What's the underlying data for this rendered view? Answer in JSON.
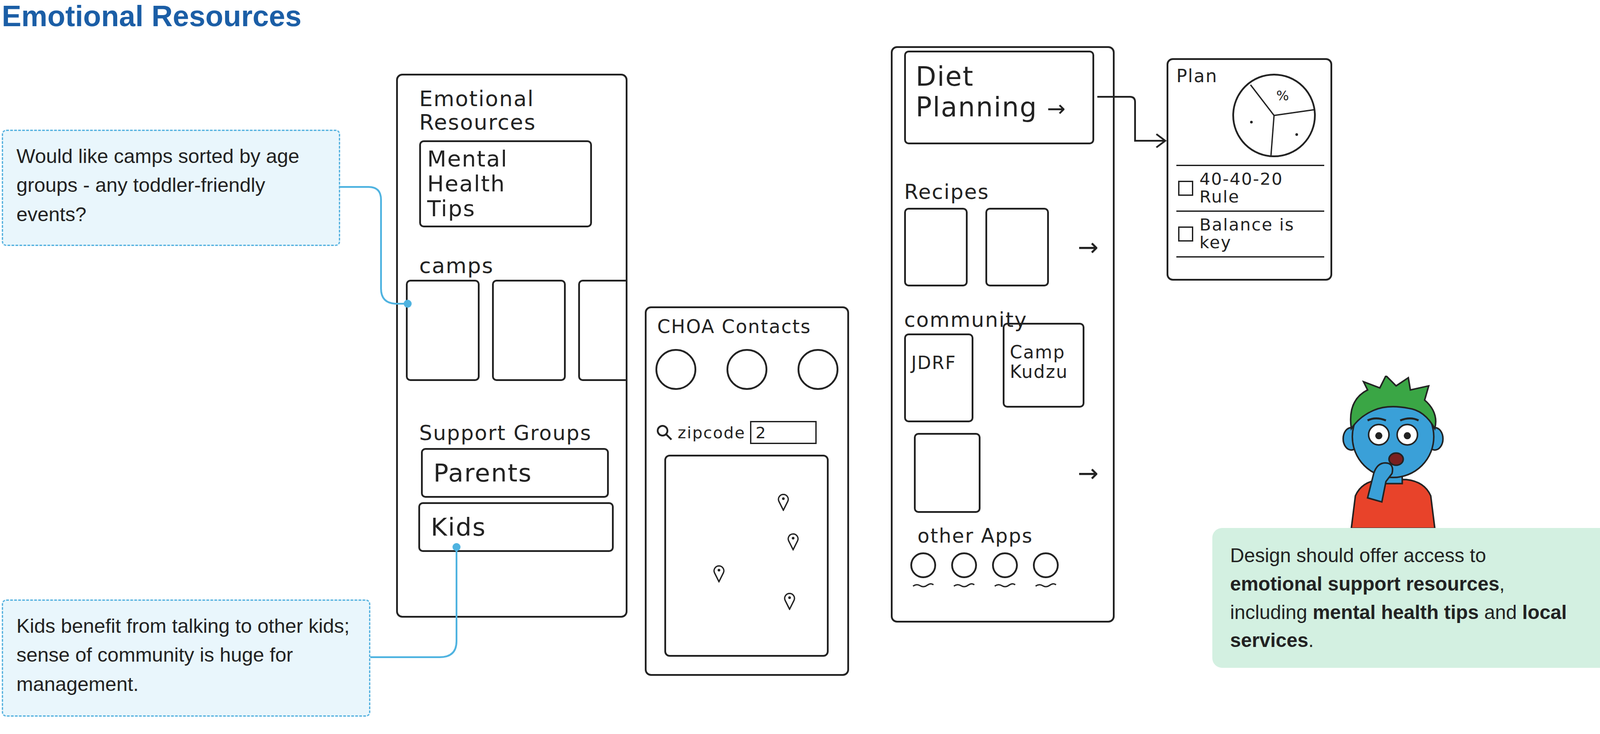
{
  "title": "Emotional Resources",
  "notes": [
    {
      "text": "Would like camps sorted by age groups - any toddler-friendly events?"
    },
    {
      "text": "Kids benefit from talking to other kids; sense of community is huge for management."
    }
  ],
  "emotional_screen": {
    "title": "Emotional Resources",
    "tips": "Mental Health Tips",
    "camps_label": "camps",
    "support_label": "Support Groups",
    "groups": [
      "Parents",
      "Kids"
    ]
  },
  "contacts_screen": {
    "title": "CHOA Contacts",
    "search_label": "zipcode",
    "search_value": "2"
  },
  "diet_screen": {
    "title": "Diet Planning",
    "title_arrow": "→",
    "recipes_label": "Recipes",
    "recipes_arrow": "→",
    "community_label": "community",
    "community": [
      {
        "label": "JDRF"
      },
      {
        "label": "Camp Kudzu"
      }
    ],
    "community_arrow": "→",
    "apps_label": "other Apps"
  },
  "plan_screen": {
    "title": "Plan",
    "pie_label": "%",
    "items": [
      {
        "text": "40-40-20 Rule",
        "checked": false
      },
      {
        "text": "Balance is key",
        "checked": false
      }
    ]
  },
  "takeaway": {
    "segments": [
      {
        "text": "Design should offer access to ",
        "bold": false
      },
      {
        "text": "emotional support resources",
        "bold": true
      },
      {
        "text": ", including ",
        "bold": false
      },
      {
        "text": "mental health tips",
        "bold": true
      },
      {
        "text": " and ",
        "bold": false
      },
      {
        "text": "local services",
        "bold": true
      },
      {
        "text": ".",
        "bold": false
      }
    ]
  }
}
